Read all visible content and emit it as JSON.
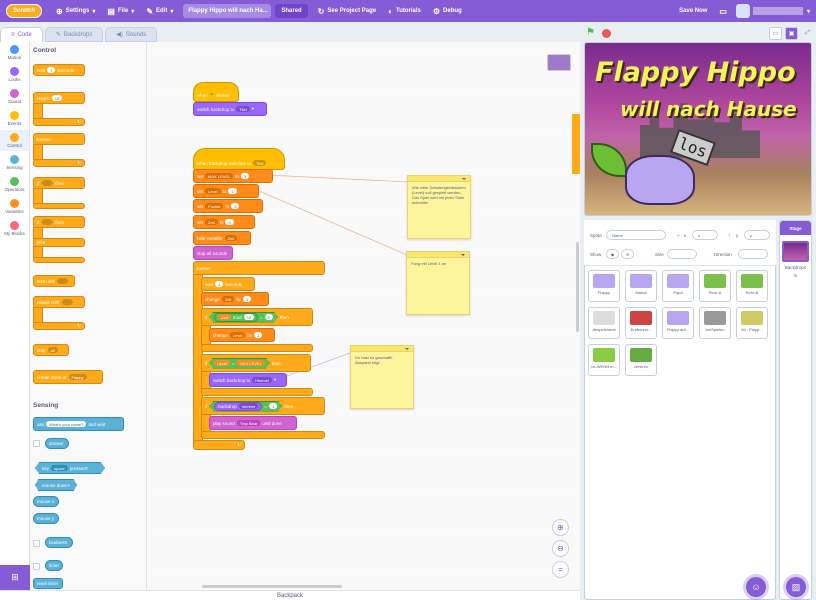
{
  "menu": {
    "logo": "Scratch",
    "settings": "Settings",
    "file": "File",
    "edit": "Edit",
    "project_title": "Flappy Hippo will nach Ha...",
    "shared": "Shared",
    "see_project": "See Project Page",
    "tutorials": "Tutorials",
    "debug": "Debug",
    "save_now": "Save Now"
  },
  "tabs": {
    "code": "Code",
    "backdrops": "Backdrops",
    "sounds": "Sounds"
  },
  "categories": [
    {
      "label": "Motion",
      "color": "#4c97ff"
    },
    {
      "label": "Looks",
      "color": "#9966ff"
    },
    {
      "label": "Sound",
      "color": "#cf63cf"
    },
    {
      "label": "Events",
      "color": "#ffbf00"
    },
    {
      "label": "Control",
      "color": "#ffab19"
    },
    {
      "label": "Sensing",
      "color": "#5cb1d6"
    },
    {
      "label": "Operators",
      "color": "#59c059"
    },
    {
      "label": "Variables",
      "color": "#ff8c1a"
    },
    {
      "label": "My Blocks",
      "color": "#ff6680"
    }
  ],
  "palette": {
    "control_head": "Control",
    "sensing_head": "Sensing",
    "wait": "wait",
    "wait_val": "1",
    "seconds": "seconds",
    "repeat": "repeat",
    "repeat_val": "10",
    "forever": "forever",
    "if": "if",
    "then": "then",
    "else": "else",
    "wait_until": "wait until",
    "repeat_until": "repeat until",
    "stop": "stop",
    "stop_val": "all",
    "create_clone": "create clone of",
    "clone_val": "Flappy",
    "ask": "ask",
    "ask_val": "What's your name?",
    "and_wait": "and wait",
    "answer": "answer",
    "key": "key",
    "key_val": "space",
    "pressed": "pressed?",
    "mouse_down": "mouse down?",
    "mouse_x": "mouse x",
    "mouse_y": "mouse y",
    "loudness": "loudness",
    "timer": "timer",
    "reset_timer": "reset timer"
  },
  "script1": {
    "when_flag": "when",
    "clicked": "clicked",
    "switch_backdrop": "switch backdrop to",
    "backdrop_val": "Titel"
  },
  "script2": {
    "hat": "when backdrop switches to",
    "hat_val": "Titel",
    "set": "set",
    "to": "to",
    "v1": "MAX LEVEL",
    "v1_val": "3",
    "v2": "Level",
    "v2_val": "1",
    "v3": "Punkte",
    "v3_val": "0",
    "v4": "Zeit",
    "v4_val": "0",
    "hide_variable": "hide variable",
    "hide_val": "Zeit",
    "stop_all_sounds": "stop all sounds",
    "forever": "forever",
    "wait": "wait",
    "wait_val": "1",
    "seconds": "seconds",
    "change": "change",
    "by": "by",
    "change1_var": "Zeit",
    "change1_val": "1",
    "if": "if",
    "then": "then",
    "mod_var": "Zeit",
    "mod": "mod",
    "mod_val": "10",
    "eq": "=",
    "eq_val": "0",
    "change2_var": "Level",
    "change2_val": "1",
    "if2_a": "Level",
    "if2_b": "MAX LEVEL",
    "switch_backdrop": "switch backdrop to",
    "switch_val": "Himmel",
    "backdrop": "backdrop",
    "number": "number",
    "bd_val": "1",
    "play_sound": "play sound",
    "sound_val": "Trap Beat",
    "until_done": "until done"
  },
  "notes": [
    {
      "text": "Wie viele Schwierigkeitsstufen (Level) soll gespielt werden. Das Spiel wird mit jeder Stufe schneller"
    },
    {
      "text": "Fang mit Level 1 an"
    },
    {
      "text": "Du hast es geschafft! Abspann folgt"
    }
  ],
  "stage": {
    "title1": "Flappy Hippo",
    "title2": "will nach Hause",
    "los": "los"
  },
  "sprite_info": {
    "sprite": "Sprite",
    "name_ph": "Name",
    "x": "x",
    "y": "y",
    "show": "Show",
    "size": "Size",
    "direction": "Direction"
  },
  "sprites": [
    {
      "name": "Flappy",
      "color": "#b8a6f0"
    },
    {
      "name": "Mama",
      "color": "#b8a6f0"
    },
    {
      "name": "Papa",
      "color": "#b8a6f0"
    },
    {
      "name": "Rohr-A",
      "color": "#7cc04c"
    },
    {
      "name": "Rohr-B",
      "color": "#7cc04c"
    },
    {
      "name": "Abspeicherst",
      "color": "#dddddd"
    },
    {
      "name": "Entfernun...",
      "color": "#cc4444"
    },
    {
      "name": "Flappy auf...",
      "color": "#b8a6f0"
    },
    {
      "name": "btnSpielen",
      "color": "#999999"
    },
    {
      "name": "txt - Flapp...",
      "color": "#cccc66"
    },
    {
      "name": "txt-WENN m...",
      "color": "#88cc44"
    },
    {
      "name": "versiren",
      "color": "#66aa44"
    }
  ],
  "stage_pane": {
    "header": "Stage",
    "backdrops_label": "Backdrops",
    "backdrops_count": "5"
  },
  "backpack": "Backpack"
}
